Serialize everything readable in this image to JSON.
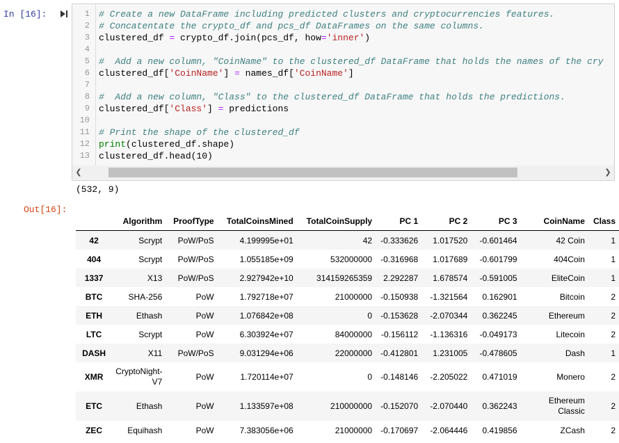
{
  "input_prompt": "In [16]:",
  "output_prompt": "Out[16]:",
  "code_lines": [
    {
      "n": "1",
      "parts": [
        {
          "c": "cm",
          "t": "# Create a new DataFrame including predicted clusters and cryptocurrencies features."
        }
      ]
    },
    {
      "n": "2",
      "parts": [
        {
          "c": "cm",
          "t": "# Concatentate the crypto_df and pcs_df DataFrames on the same columns."
        }
      ]
    },
    {
      "n": "3",
      "parts": [
        {
          "c": "",
          "t": "clustered_df "
        },
        {
          "c": "op",
          "t": "="
        },
        {
          "c": "",
          "t": " crypto_df.join(pcs_df, how"
        },
        {
          "c": "op",
          "t": "="
        },
        {
          "c": "st",
          "t": "'inner'"
        },
        {
          "c": "",
          "t": ")"
        }
      ]
    },
    {
      "n": "4",
      "parts": []
    },
    {
      "n": "5",
      "parts": [
        {
          "c": "cm",
          "t": "#  Add a new column, \"CoinName\" to the clustered_df DataFrame that holds the names of the cry"
        }
      ]
    },
    {
      "n": "6",
      "parts": [
        {
          "c": "",
          "t": "clustered_df["
        },
        {
          "c": "st",
          "t": "'CoinName'"
        },
        {
          "c": "",
          "t": "] "
        },
        {
          "c": "op",
          "t": "="
        },
        {
          "c": "",
          "t": " names_df["
        },
        {
          "c": "st",
          "t": "'CoinName'"
        },
        {
          "c": "",
          "t": "]"
        }
      ]
    },
    {
      "n": "7",
      "parts": []
    },
    {
      "n": "8",
      "parts": [
        {
          "c": "cm",
          "t": "#  Add a new column, \"Class\" to the clustered_df DataFrame that holds the predictions."
        }
      ]
    },
    {
      "n": "9",
      "parts": [
        {
          "c": "",
          "t": "clustered_df["
        },
        {
          "c": "st",
          "t": "'Class'"
        },
        {
          "c": "",
          "t": "] "
        },
        {
          "c": "op",
          "t": "="
        },
        {
          "c": "",
          "t": " predictions"
        }
      ]
    },
    {
      "n": "10",
      "parts": []
    },
    {
      "n": "11",
      "parts": [
        {
          "c": "cm",
          "t": "# Print the shape of the clustered_df"
        }
      ]
    },
    {
      "n": "12",
      "parts": [
        {
          "c": "bi",
          "t": "print"
        },
        {
          "c": "",
          "t": "(clustered_df.shape)"
        }
      ]
    },
    {
      "n": "13",
      "parts": [
        {
          "c": "",
          "t": "clustered_df.head(10)"
        }
      ]
    }
  ],
  "stdout": "(532, 9)",
  "table": {
    "columns": [
      "",
      "Algorithm",
      "ProofType",
      "TotalCoinsMined",
      "TotalCoinSupply",
      "PC 1",
      "PC 2",
      "PC 3",
      "CoinName",
      "Class"
    ],
    "rows": [
      [
        "42",
        "Scrypt",
        "PoW/PoS",
        "4.199995e+01",
        "42",
        "-0.333626",
        "1.017520",
        "-0.601464",
        "42 Coin",
        "1"
      ],
      [
        "404",
        "Scrypt",
        "PoW/PoS",
        "1.055185e+09",
        "532000000",
        "-0.316968",
        "1.017689",
        "-0.601799",
        "404Coin",
        "1"
      ],
      [
        "1337",
        "X13",
        "PoW/PoS",
        "2.927942e+10",
        "314159265359",
        "2.292287",
        "1.678574",
        "-0.591005",
        "EliteCoin",
        "1"
      ],
      [
        "BTC",
        "SHA-256",
        "PoW",
        "1.792718e+07",
        "21000000",
        "-0.150938",
        "-1.321564",
        "0.162901",
        "Bitcoin",
        "2"
      ],
      [
        "ETH",
        "Ethash",
        "PoW",
        "1.076842e+08",
        "0",
        "-0.153628",
        "-2.070344",
        "0.362245",
        "Ethereum",
        "2"
      ],
      [
        "LTC",
        "Scrypt",
        "PoW",
        "6.303924e+07",
        "84000000",
        "-0.156112",
        "-1.136316",
        "-0.049173",
        "Litecoin",
        "2"
      ],
      [
        "DASH",
        "X11",
        "PoW/PoS",
        "9.031294e+06",
        "22000000",
        "-0.412801",
        "1.231005",
        "-0.478605",
        "Dash",
        "1"
      ],
      [
        "XMR",
        "CryptoNight-V7",
        "PoW",
        "1.720114e+07",
        "0",
        "-0.148146",
        "-2.205022",
        "0.471019",
        "Monero",
        "2"
      ],
      [
        "ETC",
        "Ethash",
        "PoW",
        "1.133597e+08",
        "210000000",
        "-0.152070",
        "-2.070440",
        "0.362243",
        "Ethereum Classic",
        "2"
      ],
      [
        "ZEC",
        "Equihash",
        "PoW",
        "7.383056e+06",
        "21000000",
        "-0.170697",
        "-2.064446",
        "0.419856",
        "ZCash",
        "2"
      ]
    ]
  },
  "colors": {
    "in_prompt": "#303f9f",
    "out_prompt": "#d84315",
    "comment": "#408080",
    "string": "#ba2121",
    "operator": "#aa22ff",
    "builtin": "#008000"
  }
}
